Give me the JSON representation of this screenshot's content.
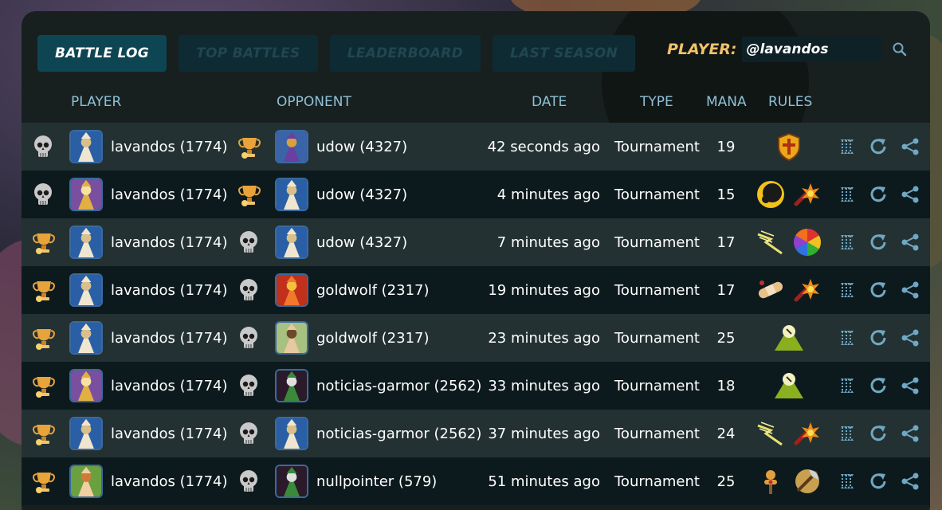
{
  "tabs": [
    {
      "label": "BATTLE LOG",
      "active": true
    },
    {
      "label": "TOP BATTLES",
      "active": false
    },
    {
      "label": "LEADERBOARD",
      "active": false
    },
    {
      "label": "LAST SEASON",
      "active": false
    }
  ],
  "player": {
    "label": "PLAYER:",
    "value": "@lavandos"
  },
  "headers": {
    "player": "PLAYER",
    "opponent": "OPPONENT",
    "date": "DATE",
    "type": "TYPE",
    "mana": "MANA",
    "rules": "RULES"
  },
  "colors": {
    "panel": "#17201f",
    "row_light": "#233132",
    "row_dark": "#0d1a1d",
    "header_text": "#8fc0d6",
    "accent_gold": "#f2c26a",
    "icon_blue": "#6fa8c4"
  },
  "rows": [
    {
      "player_result": "loss-skull-icon",
      "player": "lavandos (1774)",
      "player_avatar": "wizard-blue",
      "opp_result": "win-trophy-icon",
      "opponent": "udow (4327)",
      "opp_avatar": "dragon-purple",
      "date": "42 seconds ago",
      "type": "Tournament",
      "mana": "19",
      "rules": [
        "shield-rule-icon"
      ]
    },
    {
      "player_result": "loss-skull-icon",
      "player": "lavandos (1774)",
      "player_avatar": "gold-knight",
      "opp_result": "win-trophy-icon",
      "opponent": "udow (4327)",
      "opp_avatar": "wizard-blue",
      "date": "4 minutes ago",
      "type": "Tournament",
      "mana": "15",
      "rules": [
        "eclipse-rule-icon",
        "explosion-rule-icon"
      ]
    },
    {
      "player_result": "win-trophy-icon",
      "player": "lavandos (1774)",
      "player_avatar": "wizard-blue",
      "opp_result": "loss-skull-icon",
      "opponent": "udow (4327)",
      "opp_avatar": "wizard-blue",
      "date": "7 minutes ago",
      "type": "Tournament",
      "mana": "17",
      "rules": [
        "lightning-rule-icon",
        "rainbow-rule-icon"
      ]
    },
    {
      "player_result": "win-trophy-icon",
      "player": "lavandos (1774)",
      "player_avatar": "wizard-blue",
      "opp_result": "loss-skull-icon",
      "opponent": "goldwolf (2317)",
      "opp_avatar": "red-dragon",
      "date": "19 minutes ago",
      "type": "Tournament",
      "mana": "17",
      "rules": [
        "bandage-rule-icon",
        "explosion-rule-icon"
      ]
    },
    {
      "player_result": "win-trophy-icon",
      "player": "lavandos (1774)",
      "player_avatar": "wizard-blue",
      "opp_result": "loss-skull-icon",
      "opponent": "goldwolf (2317)",
      "opp_avatar": "human-hero",
      "date": "23 minutes ago",
      "type": "Tournament",
      "mana": "25",
      "rules": [
        "mountain-rule-icon"
      ]
    },
    {
      "player_result": "win-trophy-icon",
      "player": "lavandos (1774)",
      "player_avatar": "gold-knight",
      "opp_result": "loss-skull-icon",
      "opponent": "noticias-garmor (2562)",
      "opp_avatar": "dark-demon",
      "date": "33 minutes ago",
      "type": "Tournament",
      "mana": "18",
      "rules": [
        "mountain-rule-icon"
      ]
    },
    {
      "player_result": "win-trophy-icon",
      "player": "lavandos (1774)",
      "player_avatar": "wizard-blue",
      "opp_result": "loss-skull-icon",
      "opponent": "noticias-garmor (2562)",
      "opp_avatar": "wizard-blue",
      "date": "37 minutes ago",
      "type": "Tournament",
      "mana": "24",
      "rules": [
        "lightning-rule-icon",
        "explosion-rule-icon"
      ]
    },
    {
      "player_result": "win-trophy-icon",
      "player": "lavandos (1774)",
      "player_avatar": "green-elf",
      "opp_result": "loss-skull-icon",
      "opponent": "nullpointer (579)",
      "opp_avatar": "dark-demon",
      "date": "51 minutes ago",
      "type": "Tournament",
      "mana": "25",
      "rules": [
        "training-dummy-rule-icon",
        "axe-rule-icon"
      ]
    }
  ]
}
